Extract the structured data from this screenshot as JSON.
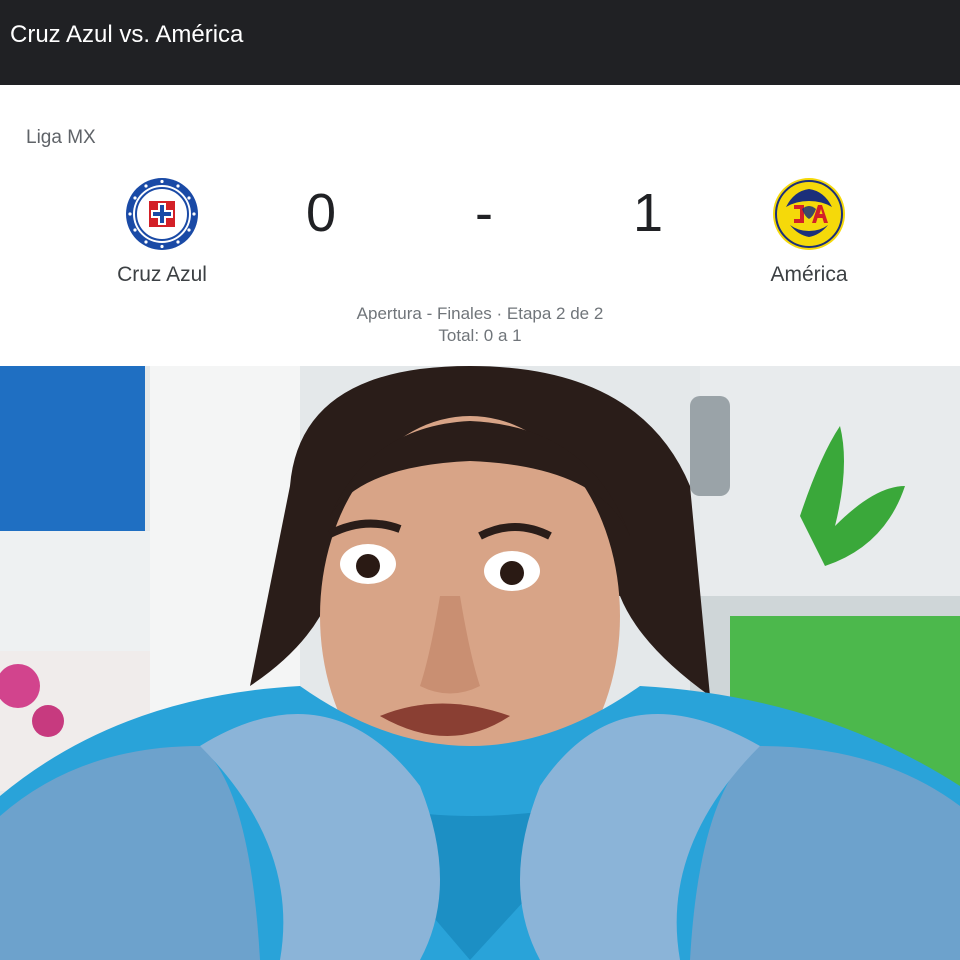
{
  "header": {
    "title": "Cruz Azul vs. América"
  },
  "match": {
    "league": "Liga MX",
    "home": {
      "name": "Cruz Azul",
      "score": "0",
      "logo_icon": "cruz-azul-crest-icon"
    },
    "away": {
      "name": "América",
      "score": "1",
      "logo_icon": "club-america-crest-icon"
    },
    "separator": "-",
    "stage": "Apertura - Finales · Etapa 2 de 2",
    "aggregate": "Total: 0 a 1"
  },
  "image": {
    "subject": "meme-photo-startled-man"
  },
  "colors": {
    "header_bg": "#202124",
    "cruz_azul_blue": "#1a4aa6",
    "america_yellow": "#f5d90a",
    "america_blue": "#1b2f7a"
  }
}
